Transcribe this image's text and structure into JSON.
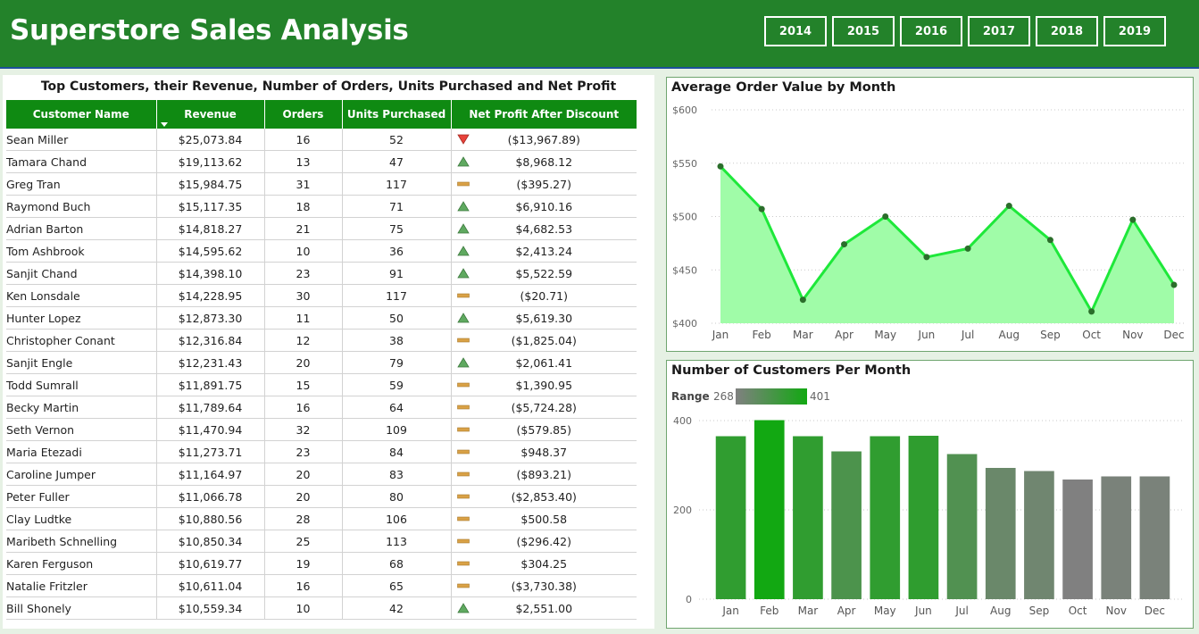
{
  "header": {
    "title": "Superstore Sales Analysis",
    "years": [
      "2014",
      "2015",
      "2016",
      "2017",
      "2018",
      "2019"
    ]
  },
  "colors": {
    "header_bg": "#23822a",
    "table_header_bg": "#0f8a12",
    "line": "#1ee83a",
    "area": "#a0fca8",
    "marker": "#2b6e2b",
    "up_triangle": "#5fa960",
    "down_triangle": "#e8423a",
    "flat_bar": "#d9a146"
  },
  "table": {
    "title": "Top Customers, their Revenue, Number of Orders, Units Purchased and Net Profit",
    "columns": [
      "Customer Name",
      "Revenue",
      "Orders",
      "Units Purchased",
      "Net Profit After Discount"
    ],
    "rows": [
      {
        "name": "Sean Miller",
        "revenue": "$25,073.84",
        "orders": "16",
        "units": "52",
        "status": "down",
        "profit": "($13,967.89)"
      },
      {
        "name": "Tamara Chand",
        "revenue": "$19,113.62",
        "orders": "13",
        "units": "47",
        "status": "up",
        "profit": "$8,968.12"
      },
      {
        "name": "Greg Tran",
        "revenue": "$15,984.75",
        "orders": "31",
        "units": "117",
        "status": "flat",
        "profit": "($395.27)"
      },
      {
        "name": "Raymond Buch",
        "revenue": "$15,117.35",
        "orders": "18",
        "units": "71",
        "status": "up",
        "profit": "$6,910.16"
      },
      {
        "name": "Adrian Barton",
        "revenue": "$14,818.27",
        "orders": "21",
        "units": "75",
        "status": "up",
        "profit": "$4,682.53"
      },
      {
        "name": "Tom Ashbrook",
        "revenue": "$14,595.62",
        "orders": "10",
        "units": "36",
        "status": "up",
        "profit": "$2,413.24"
      },
      {
        "name": "Sanjit Chand",
        "revenue": "$14,398.10",
        "orders": "23",
        "units": "91",
        "status": "up",
        "profit": "$5,522.59"
      },
      {
        "name": "Ken Lonsdale",
        "revenue": "$14,228.95",
        "orders": "30",
        "units": "117",
        "status": "flat",
        "profit": "($20.71)"
      },
      {
        "name": "Hunter Lopez",
        "revenue": "$12,873.30",
        "orders": "11",
        "units": "50",
        "status": "up",
        "profit": "$5,619.30"
      },
      {
        "name": "Christopher Conant",
        "revenue": "$12,316.84",
        "orders": "12",
        "units": "38",
        "status": "flat",
        "profit": "($1,825.04)"
      },
      {
        "name": "Sanjit Engle",
        "revenue": "$12,231.43",
        "orders": "20",
        "units": "79",
        "status": "up",
        "profit": "$2,061.41"
      },
      {
        "name": "Todd Sumrall",
        "revenue": "$11,891.75",
        "orders": "15",
        "units": "59",
        "status": "flat",
        "profit": "$1,390.95"
      },
      {
        "name": "Becky Martin",
        "revenue": "$11,789.64",
        "orders": "16",
        "units": "64",
        "status": "flat",
        "profit": "($5,724.28)"
      },
      {
        "name": "Seth Vernon",
        "revenue": "$11,470.94",
        "orders": "32",
        "units": "109",
        "status": "flat",
        "profit": "($579.85)"
      },
      {
        "name": "Maria Etezadi",
        "revenue": "$11,273.71",
        "orders": "23",
        "units": "84",
        "status": "flat",
        "profit": "$948.37"
      },
      {
        "name": "Caroline Jumper",
        "revenue": "$11,164.97",
        "orders": "20",
        "units": "83",
        "status": "flat",
        "profit": "($893.21)"
      },
      {
        "name": "Peter Fuller",
        "revenue": "$11,066.78",
        "orders": "20",
        "units": "80",
        "status": "flat",
        "profit": "($2,853.40)"
      },
      {
        "name": "Clay Ludtke",
        "revenue": "$10,880.56",
        "orders": "28",
        "units": "106",
        "status": "flat",
        "profit": "$500.58"
      },
      {
        "name": "Maribeth Schnelling",
        "revenue": "$10,850.34",
        "orders": "25",
        "units": "113",
        "status": "flat",
        "profit": "($296.42)"
      },
      {
        "name": "Karen Ferguson",
        "revenue": "$10,619.77",
        "orders": "19",
        "units": "68",
        "status": "flat",
        "profit": "$304.25"
      },
      {
        "name": "Natalie Fritzler",
        "revenue": "$10,611.04",
        "orders": "16",
        "units": "65",
        "status": "flat",
        "profit": "($3,730.38)"
      },
      {
        "name": "Bill Shonely",
        "revenue": "$10,559.34",
        "orders": "10",
        "units": "42",
        "status": "up",
        "profit": "$2,551.00"
      }
    ]
  },
  "chart_data": [
    {
      "type": "area",
      "title": "Average Order Value by Month",
      "categories": [
        "Jan",
        "Feb",
        "Mar",
        "Apr",
        "May",
        "Jun",
        "Jul",
        "Aug",
        "Sep",
        "Oct",
        "Nov",
        "Dec"
      ],
      "values": [
        547,
        507,
        422,
        474,
        500,
        462,
        470,
        510,
        478,
        411,
        497,
        436
      ],
      "ylim": [
        400,
        600
      ],
      "yticks": [
        400,
        450,
        500,
        550,
        600
      ],
      "ytick_labels": [
        "$400",
        "$450",
        "$500",
        "$550",
        "$600"
      ],
      "grid": true,
      "xlabel": "",
      "ylabel": ""
    },
    {
      "type": "bar",
      "title": "Number of Customers Per Month",
      "categories": [
        "Jan",
        "Feb",
        "Mar",
        "Apr",
        "May",
        "Jun",
        "Jul",
        "Aug",
        "Sep",
        "Oct",
        "Nov",
        "Dec"
      ],
      "values": [
        365,
        401,
        365,
        331,
        365,
        366,
        325,
        294,
        287,
        268,
        275,
        275
      ],
      "ylim": [
        0,
        450
      ],
      "yticks": [
        0,
        200,
        400
      ],
      "ytick_labels": [
        "0",
        "200",
        "400"
      ],
      "grid": true,
      "legend": {
        "label": "Range",
        "min_label": "268",
        "max_label": "401",
        "min": 268,
        "max": 401
      },
      "color_range": [
        "#808080",
        "#12a812"
      ],
      "xlabel": "",
      "ylabel": ""
    }
  ]
}
